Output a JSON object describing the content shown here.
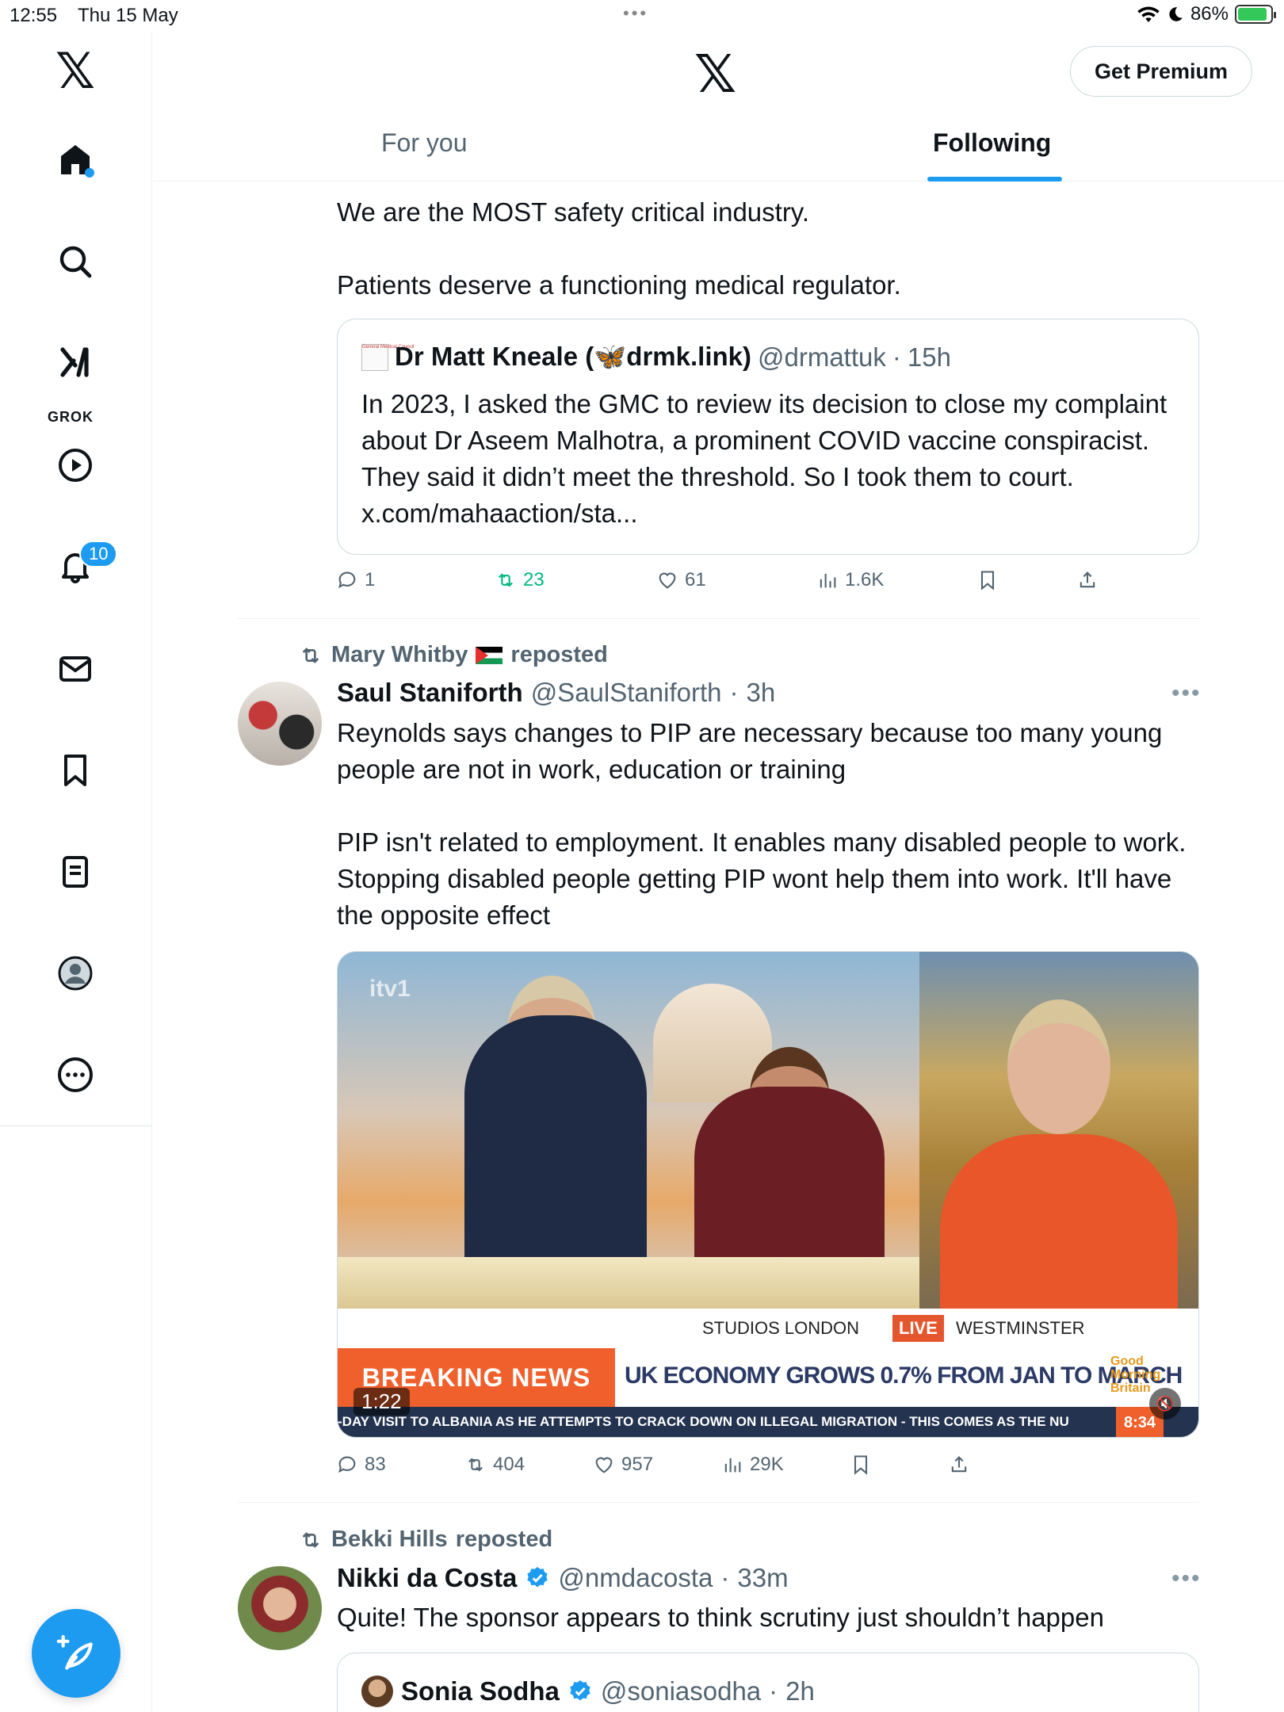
{
  "status_bar": {
    "time": "12:55",
    "date": "Thu 15 May",
    "battery": "86%",
    "dots": "•••"
  },
  "sidebar": {
    "logo": "𝕏",
    "grok_label": "GROK",
    "notifications_badge": "10",
    "items": [
      {
        "name": "home",
        "icon": "home-icon"
      },
      {
        "name": "explore",
        "icon": "search-icon"
      },
      {
        "name": "grok",
        "icon": "grok-icon"
      },
      {
        "name": "videos",
        "icon": "play-icon"
      },
      {
        "name": "notifications",
        "icon": "bell-icon"
      },
      {
        "name": "messages",
        "icon": "mail-icon"
      },
      {
        "name": "bookmarks",
        "icon": "bookmark-icon"
      },
      {
        "name": "lists",
        "icon": "list-icon"
      },
      {
        "name": "profile",
        "icon": "profile-icon"
      },
      {
        "name": "more",
        "icon": "more-icon"
      }
    ]
  },
  "header": {
    "logo": "𝕏",
    "premium_label": "Get Premium",
    "tabs": [
      {
        "label": "For you",
        "active": false
      },
      {
        "label": "Following",
        "active": true
      }
    ]
  },
  "colors": {
    "accent": "#1d9bf0",
    "repost_green": "#00ba7c",
    "secondary_text": "#536471"
  },
  "post1": {
    "text_line1": "We are the MOST safety critical industry.",
    "text_line2": "Patients deserve a functioning medical regulator.",
    "quote": {
      "name": "Dr Matt Kneale (🦋drmk.link)",
      "handle": "@drmattuk",
      "time": "15h",
      "body": "In 2023, I asked the GMC to review its decision to close my complaint about Dr Aseem Malhotra, a prominent COVID vaccine conspiracist. They said it didn’t meet the threshold. So I took them to court. x.com/mahaaction/sta..."
    },
    "replies": "1",
    "reposts": "23",
    "likes": "61",
    "views": "1.6K"
  },
  "post2": {
    "reposted_by": "Mary Whitby",
    "reposted_label": "reposted",
    "name": "Saul Staniforth",
    "handle": "@SaulStaniforth",
    "time": "3h",
    "text_para1": "Reynolds says changes to PIP are necessary because too many young people are not in work, education or training",
    "text_para2": "PIP isn't related to employment. It enables many disabled people to work. Stopping disabled people getting PIP wont help them into work. It'll have the opposite effect",
    "video": {
      "duration": "1:22",
      "channel": "itv1",
      "studio": "STUDIOS LONDON",
      "live": "LIVE",
      "location": "WESTMINSTER",
      "breaking": "BREAKING NEWS",
      "headline": "UK ECONOMY GROWS 0.7% FROM JAN TO MARCH",
      "show": "Good Morning Britain",
      "ticker": "-DAY VISIT TO ALBANIA AS HE ATTEMPTS TO CRACK DOWN ON ILLEGAL MIGRATION - THIS COMES AS THE NU",
      "clock": "8:34"
    },
    "replies": "83",
    "reposts": "404",
    "likes": "957",
    "views": "29K"
  },
  "post3": {
    "reposted_by": "Bekki Hills",
    "reposted_label": "reposted",
    "name": "Nikki da Costa",
    "handle": "@nmdacosta",
    "time": "33m",
    "text": "Quite! The sponsor appears to think scrutiny just shouldn’t happen",
    "quote": {
      "name": "Sonia Sodha",
      "handle": "@soniasodha",
      "time": "2h"
    }
  }
}
